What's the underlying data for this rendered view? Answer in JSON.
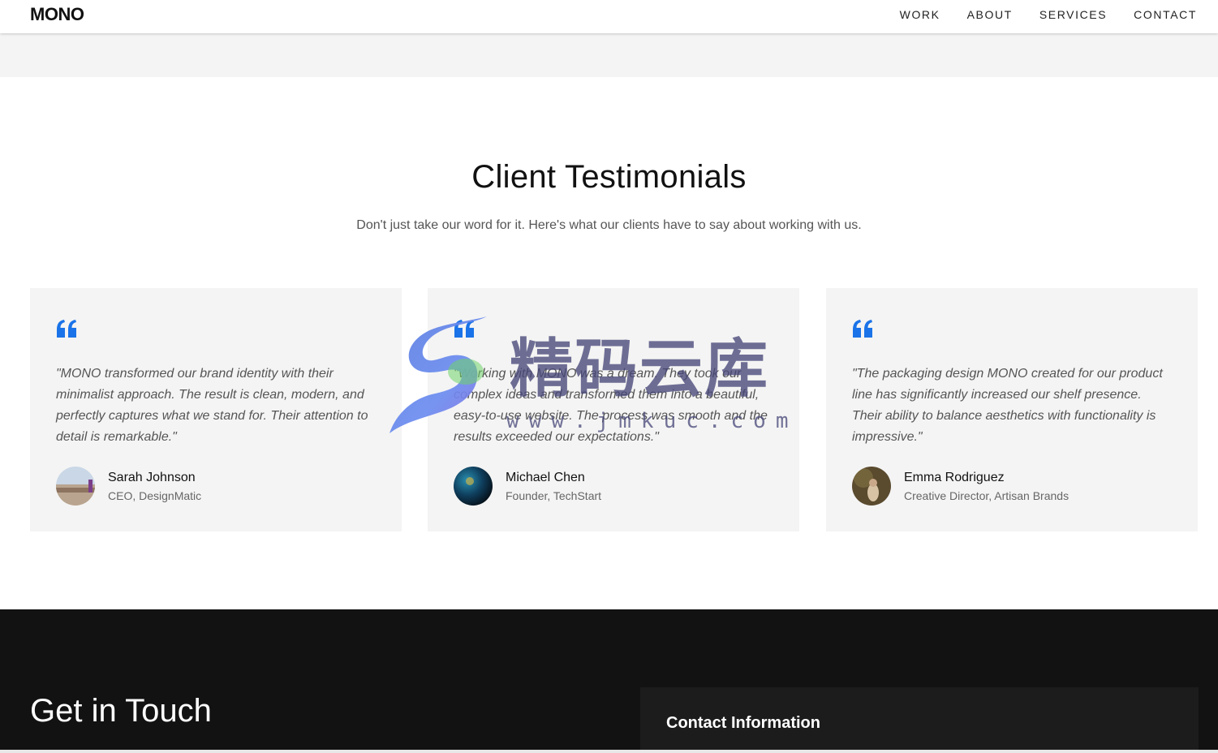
{
  "header": {
    "logo": "MONO",
    "nav": [
      {
        "label": "WORK"
      },
      {
        "label": "ABOUT"
      },
      {
        "label": "SERVICES"
      },
      {
        "label": "CONTACT"
      }
    ]
  },
  "testimonials": {
    "title": "Client Testimonials",
    "subtitle": "Don't just take our word for it. Here's what our clients have to say about working with us.",
    "accent_color": "#1a73e8",
    "items": [
      {
        "quote": "\"MONO transformed our brand identity with their minimalist approach. The result is clean, modern, and perfectly captures what we stand for. Their attention to detail is remarkable.\"",
        "name": "Sarah Johnson",
        "role": "CEO, DesignMatic"
      },
      {
        "quote": "\"Working with MONO was a dream. They took our complex ideas and transformed them into a beautiful, easy-to-use website. The process was smooth and the results exceeded our expectations.\"",
        "name": "Michael Chen",
        "role": "Founder, TechStart"
      },
      {
        "quote": "\"The packaging design MONO created for our product line has significantly increased our shelf presence. Their ability to balance aesthetics with functionality is impressive.\"",
        "name": "Emma Rodriguez",
        "role": "Creative Director, Artisan Brands"
      }
    ]
  },
  "contact": {
    "title": "Get in Touch",
    "info_title": "Contact Information"
  },
  "watermark": {
    "text": "精码云库",
    "url": "www.jmkuc.com"
  }
}
